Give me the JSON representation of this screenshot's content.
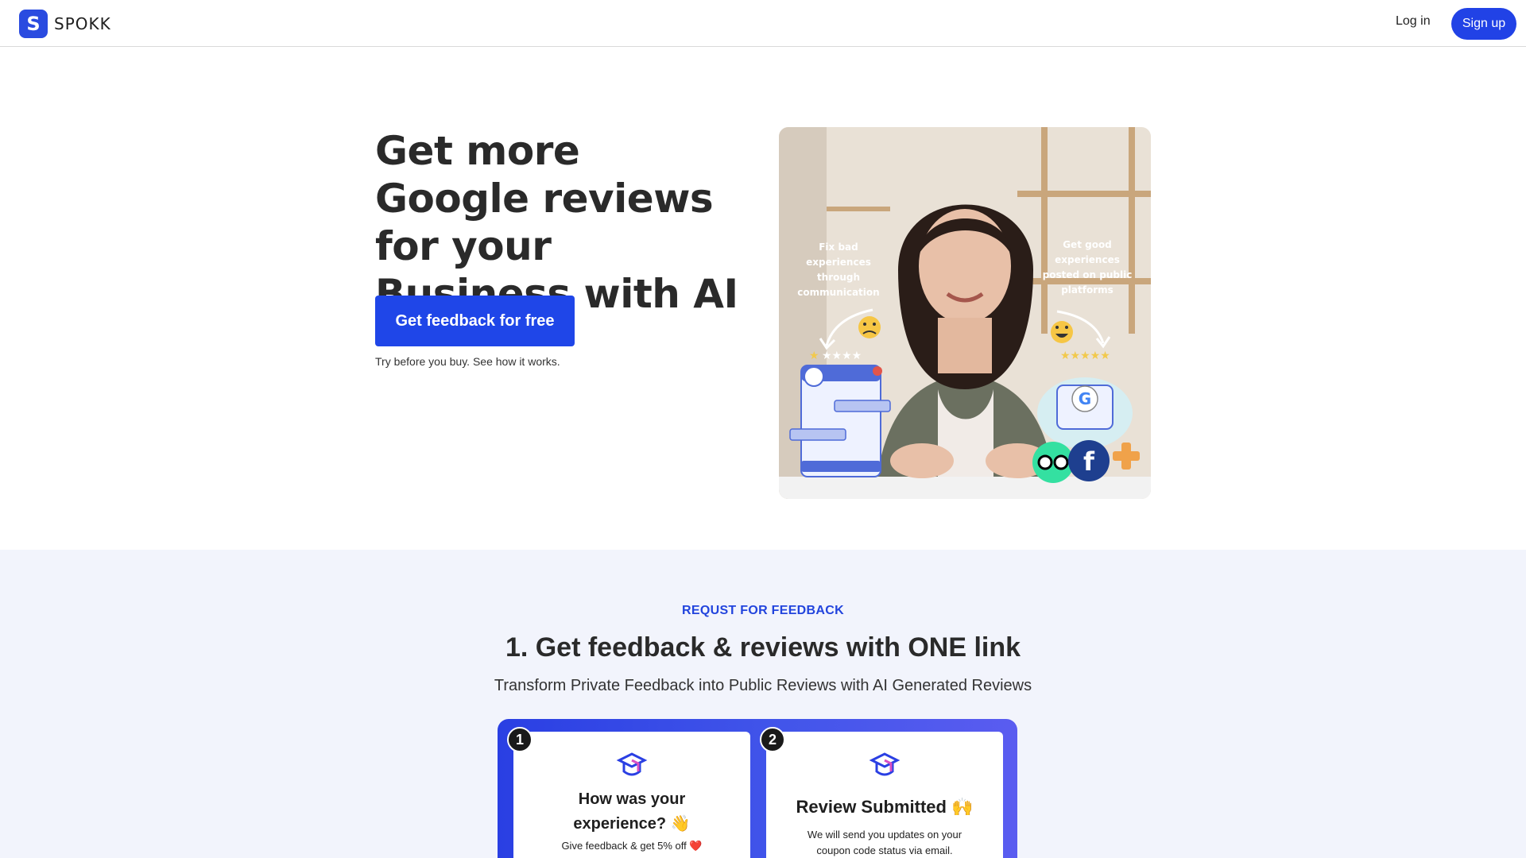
{
  "header": {
    "logo_letter": "S",
    "brand": "SPOKK",
    "login_label": "Log in",
    "signup_label": "Sign up"
  },
  "hero": {
    "title": "Get more Google reviews for your Business with AI",
    "cta_label": "Get feedback for free",
    "cta_sub": "Try before you buy. See how it works.",
    "image": {
      "left_caption": "Fix bad experiences through communication",
      "right_caption": "Get good experiences posted on public platforms",
      "left_emoji": "😟",
      "right_emoji": "😄",
      "left_stars": "★★★★★",
      "right_stars": "★★★★★"
    }
  },
  "feature": {
    "eyebrow": "REQUST FOR FEEDBACK",
    "title": "1. Get feedback & reviews with ONE link",
    "subtitle": "Transform Private Feedback into Public Reviews with AI Generated Reviews",
    "cards": [
      {
        "number": "1",
        "title": "How was your experience? 👋",
        "text": "Give feedback & get 5% off ❤️"
      },
      {
        "number": "2",
        "title": "Review Submitted 🙌",
        "text": "We will send you updates on your coupon code status via email."
      }
    ]
  },
  "colors": {
    "accent": "#2142e6",
    "eyebrow": "#2244dd",
    "section_bg": "#f2f4fc"
  }
}
